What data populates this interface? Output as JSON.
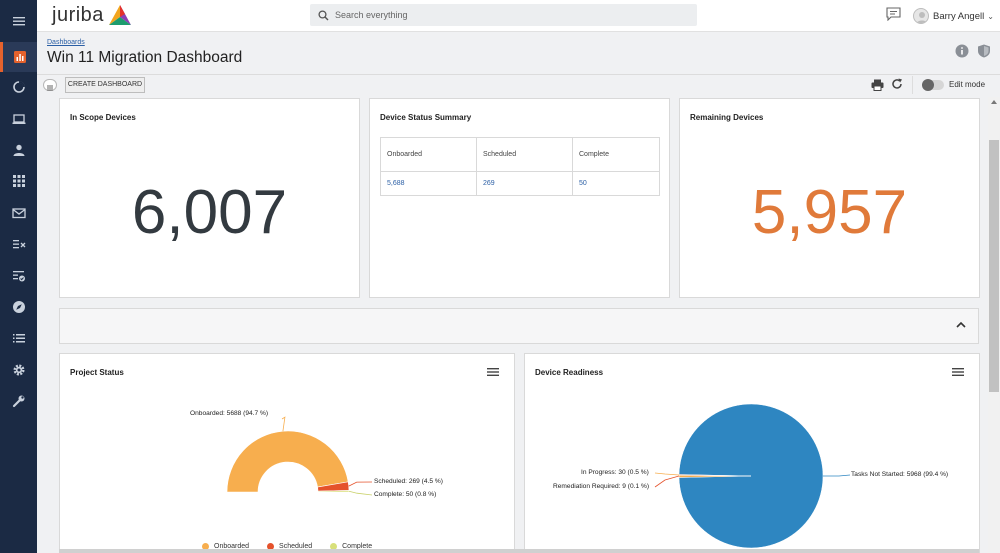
{
  "app": {
    "logo_text": "juriba"
  },
  "search": {
    "placeholder": "Search everything"
  },
  "user": {
    "name": "Barry Angell"
  },
  "header": {
    "breadcrumb": "Dashboards",
    "title": "Win 11 Migration Dashboard"
  },
  "toolbar": {
    "create_label": "CREATE DASHBOARD",
    "edit_mode_label": "Edit mode"
  },
  "widgets": {
    "in_scope": {
      "title": "In Scope Devices",
      "value": "6,007"
    },
    "status_summary": {
      "title": "Device Status Summary",
      "columns": [
        "Onboarded",
        "Scheduled",
        "Complete"
      ],
      "values": [
        "5,688",
        "269",
        "50"
      ]
    },
    "remaining": {
      "title": "Remaining Devices",
      "value": "5,957"
    },
    "project_status": {
      "title": "Project Status"
    },
    "device_readiness": {
      "title": "Device Readiness"
    }
  },
  "chart_data": [
    {
      "type": "pie",
      "variant": "semi-donut",
      "title": "Project Status",
      "categories": [
        "Onboarded",
        "Scheduled",
        "Complete"
      ],
      "values": [
        5688,
        269,
        50
      ],
      "labels": [
        "Onboarded: 5688 (94.7 %)",
        "Scheduled: 269 (4.5 %)",
        "Complete: 50 (0.8 %)"
      ],
      "colors": [
        "#f7ae4e",
        "#e5522b",
        "#d8e07a"
      ],
      "legend": [
        "Onboarded",
        "Scheduled",
        "Complete"
      ],
      "legend_position": "bottom"
    },
    {
      "type": "pie",
      "title": "Device Readiness",
      "categories": [
        "Tasks Not Started",
        "In Progress",
        "Remediation Required"
      ],
      "values": [
        5968,
        30,
        9
      ],
      "labels": [
        "Tasks Not Started: 5968 (99.4 %)",
        "In Progress: 30 (0.5 %)",
        "Remediation Required: 9 (0.1 %)"
      ],
      "colors": [
        "#2e86c1",
        "#f7ae4e",
        "#e5522b"
      ]
    }
  ],
  "colors": {
    "nav_bg": "#1b2a44",
    "accent_orange": "#e07a3a",
    "big_number_dark": "#333a40",
    "link_blue": "#2b5fa5"
  },
  "nav_icons": [
    "menu-icon",
    "dashboard-icon",
    "projects-icon",
    "devices-icon",
    "users-icon",
    "applications-icon",
    "mail-icon",
    "tasks-icon",
    "checklist-icon",
    "explore-icon",
    "list-icon",
    "settings-icon",
    "tools-icon"
  ]
}
